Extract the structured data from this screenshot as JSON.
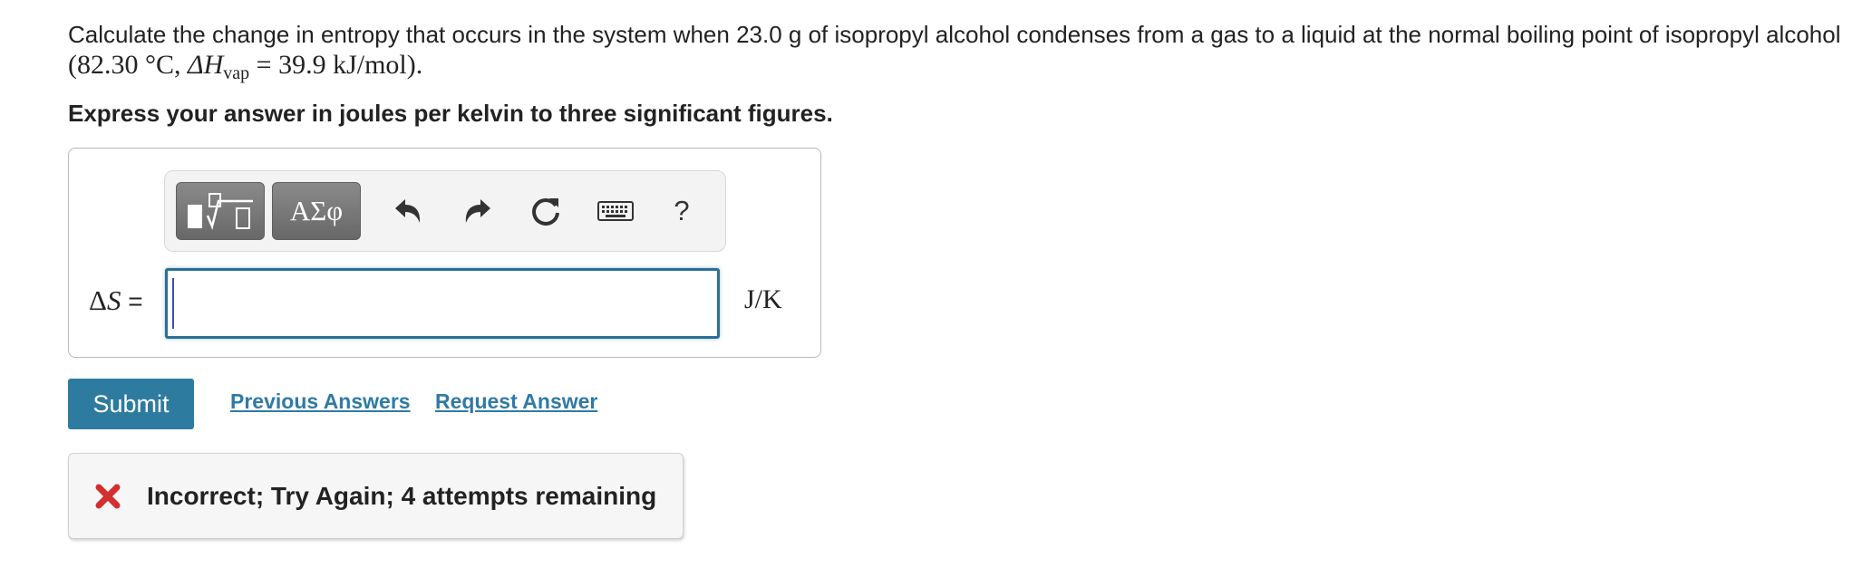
{
  "question": {
    "line1": "Calculate the change in entropy that occurs in the system when 23.0 g of isopropyl alcohol condenses from a gas to a liquid at the normal boiling point of isopropyl alcohol",
    "temp": "(82.30 °C, ",
    "delta_h": "ΔH",
    "sub_vap": "vap",
    "enthalpy": " = 39.9 kJ/mol)."
  },
  "instruction": "Express your answer in joules per kelvin to three significant figures.",
  "toolbar": {
    "greek_label": "ΑΣφ",
    "help_label": "?",
    "icons": [
      "templates-icon",
      "undo-icon",
      "redo-icon",
      "reset-icon",
      "keyboard-icon",
      "help-icon"
    ]
  },
  "answer": {
    "label_delta": "Δ",
    "label_s": "S",
    "label_eq": " =",
    "value": "",
    "unit": "J/K"
  },
  "actions": {
    "submit_label": "Submit",
    "previous_answers_label": "Previous Answers",
    "request_answer_label": "Request Answer"
  },
  "feedback": {
    "message": "Incorrect; Try Again; 4 attempts remaining"
  },
  "colors": {
    "primary": "#2e7ba0",
    "link": "#2f7aa6",
    "error": "#d32f2f",
    "input_border": "#2a6f96"
  }
}
